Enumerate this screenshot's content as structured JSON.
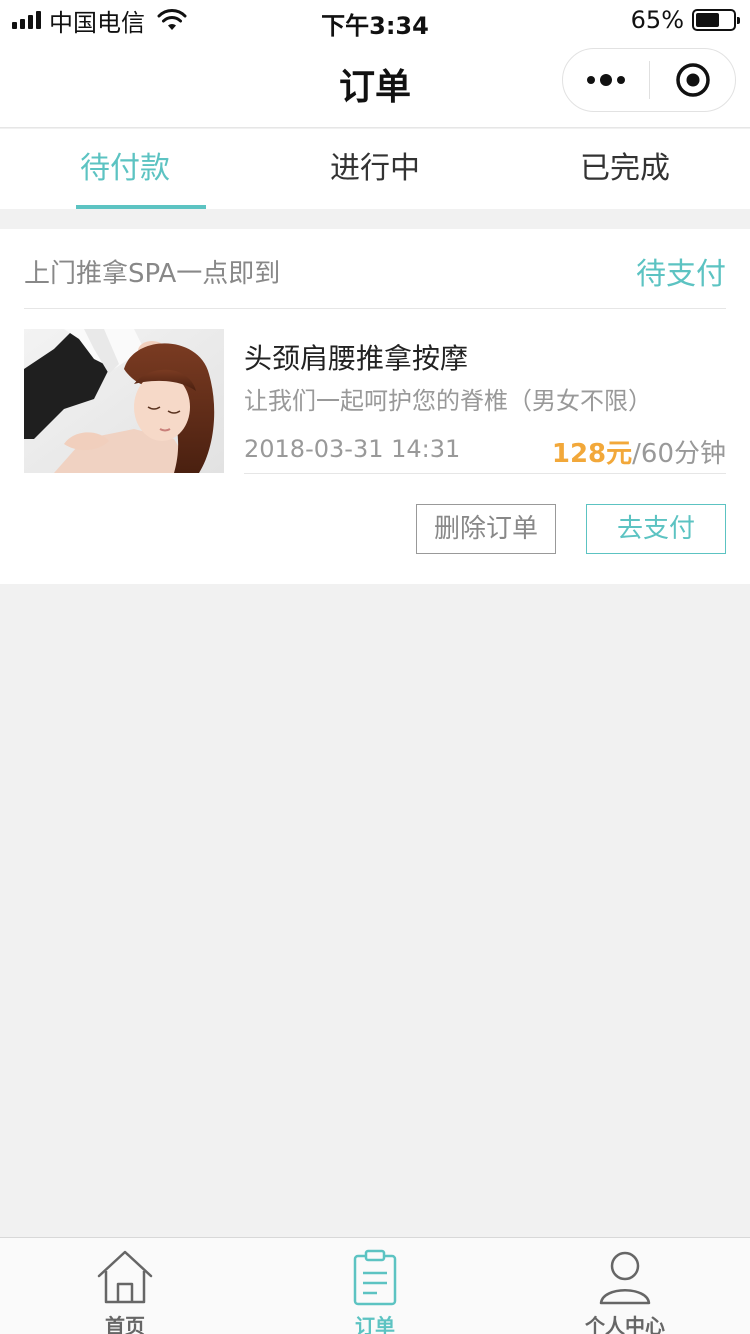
{
  "status_bar": {
    "carrier": "中国电信",
    "time": "下午3:34",
    "battery_percent": "65%",
    "battery_level": 0.65
  },
  "nav": {
    "title": "订单"
  },
  "tabs": [
    {
      "label": "待付款",
      "active": true
    },
    {
      "label": "进行中",
      "active": false
    },
    {
      "label": "已完成",
      "active": false
    }
  ],
  "order": {
    "shop_name": "上门推拿SPA一点即到",
    "status": "待支付",
    "product_name": "头颈肩腰推拿按摩",
    "product_desc": "让我们一起呵护您的脊椎（男女不限）",
    "time": "2018-03-31 14:31",
    "price": "128元",
    "duration": "/60分钟",
    "delete_label": "删除订单",
    "pay_label": "去支付"
  },
  "tab_bar": [
    {
      "label": "首页",
      "icon": "home-icon",
      "active": false
    },
    {
      "label": "订单",
      "icon": "order-clipboard-icon",
      "active": true
    },
    {
      "label": "个人中心",
      "icon": "user-profile-icon",
      "active": false
    }
  ],
  "colors": {
    "accent": "#5cc3c2",
    "price": "#f2a83a",
    "background": "#f1f1f1"
  }
}
